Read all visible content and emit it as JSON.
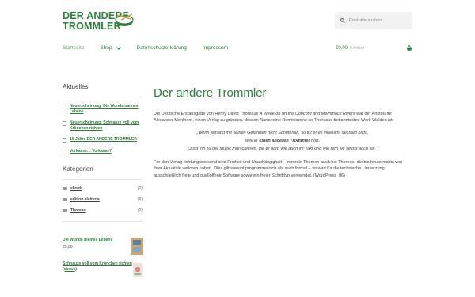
{
  "header": {
    "logo_line1": "DER ANDERE",
    "logo_line2": "TROMMLER",
    "search_placeholder": "Produkte suchen…"
  },
  "nav": {
    "items": [
      "Startseite",
      "Shop",
      "Datenschutzerklärung",
      "Impressum"
    ]
  },
  "cart": {
    "price": "€0,00",
    "count": "0 Artikel"
  },
  "sidebar": {
    "recent_title": "Aktuelles",
    "recent": [
      "Neuerscheinung: Die Wunde meines Lebens",
      "Neuerscheinung: Schnauze voll vom Krönchen richten",
      "10 Jahre DER ANDERE TROMMLER",
      "Vorkasse… Vorkasse?"
    ],
    "categories_title": "Kategorien",
    "categories": [
      {
        "name": "ebook",
        "count": "(2)"
      },
      {
        "name": "edition aleiteria",
        "count": "(6)"
      },
      {
        "name": "Thoreau",
        "count": "(2)"
      }
    ],
    "products": [
      {
        "name": "Die Wunde meines Lebens",
        "price": "€9,80"
      },
      {
        "name": "Schnauze voll vom Krönchen richten (ebook)",
        "price": ""
      }
    ]
  },
  "main": {
    "title": "Der andere Trommler",
    "p1_a": "Die Deutsche Erstausgabe von Henry David Thoreaus ",
    "p1_italic": "A Week on on the Concord and Merrimack Rivers",
    "p1_b": " war der Anstoß für Alexander Mehlhorn, einen Verlag zu gründen, dessen Name eine Reminiszenz an  Thoreaus bekanntestes Werk Walden ist:",
    "quote1": "„Wenn jemand mit seinen Gefährten nicht Schritt hält, so tut er es vielleicht deshalb nicht,",
    "quote2_a": "weil er ",
    "quote2_b": "einen anderen Trommler",
    "quote2_c": " hört.",
    "quote3": "Lasst ihn zu der Musik marschieren, die er hört, wie auch ihr Takt und wie fern sie selbst auch sei.“",
    "p2": "Für den Verlag richtungsweisend sind Freiheit und Unabhängigkeit – zentrale Themen auch bei Thoreau, die bis heute nichts von ihrer Aktualität verloren haben. Dies gilt sowohl programmatisch als auch formal – so wird für die technische Umsetzung ausschließlich freie und quelloffene Software sowie ein freier Schrifttyp verwendet. (WordPress_06)"
  }
}
